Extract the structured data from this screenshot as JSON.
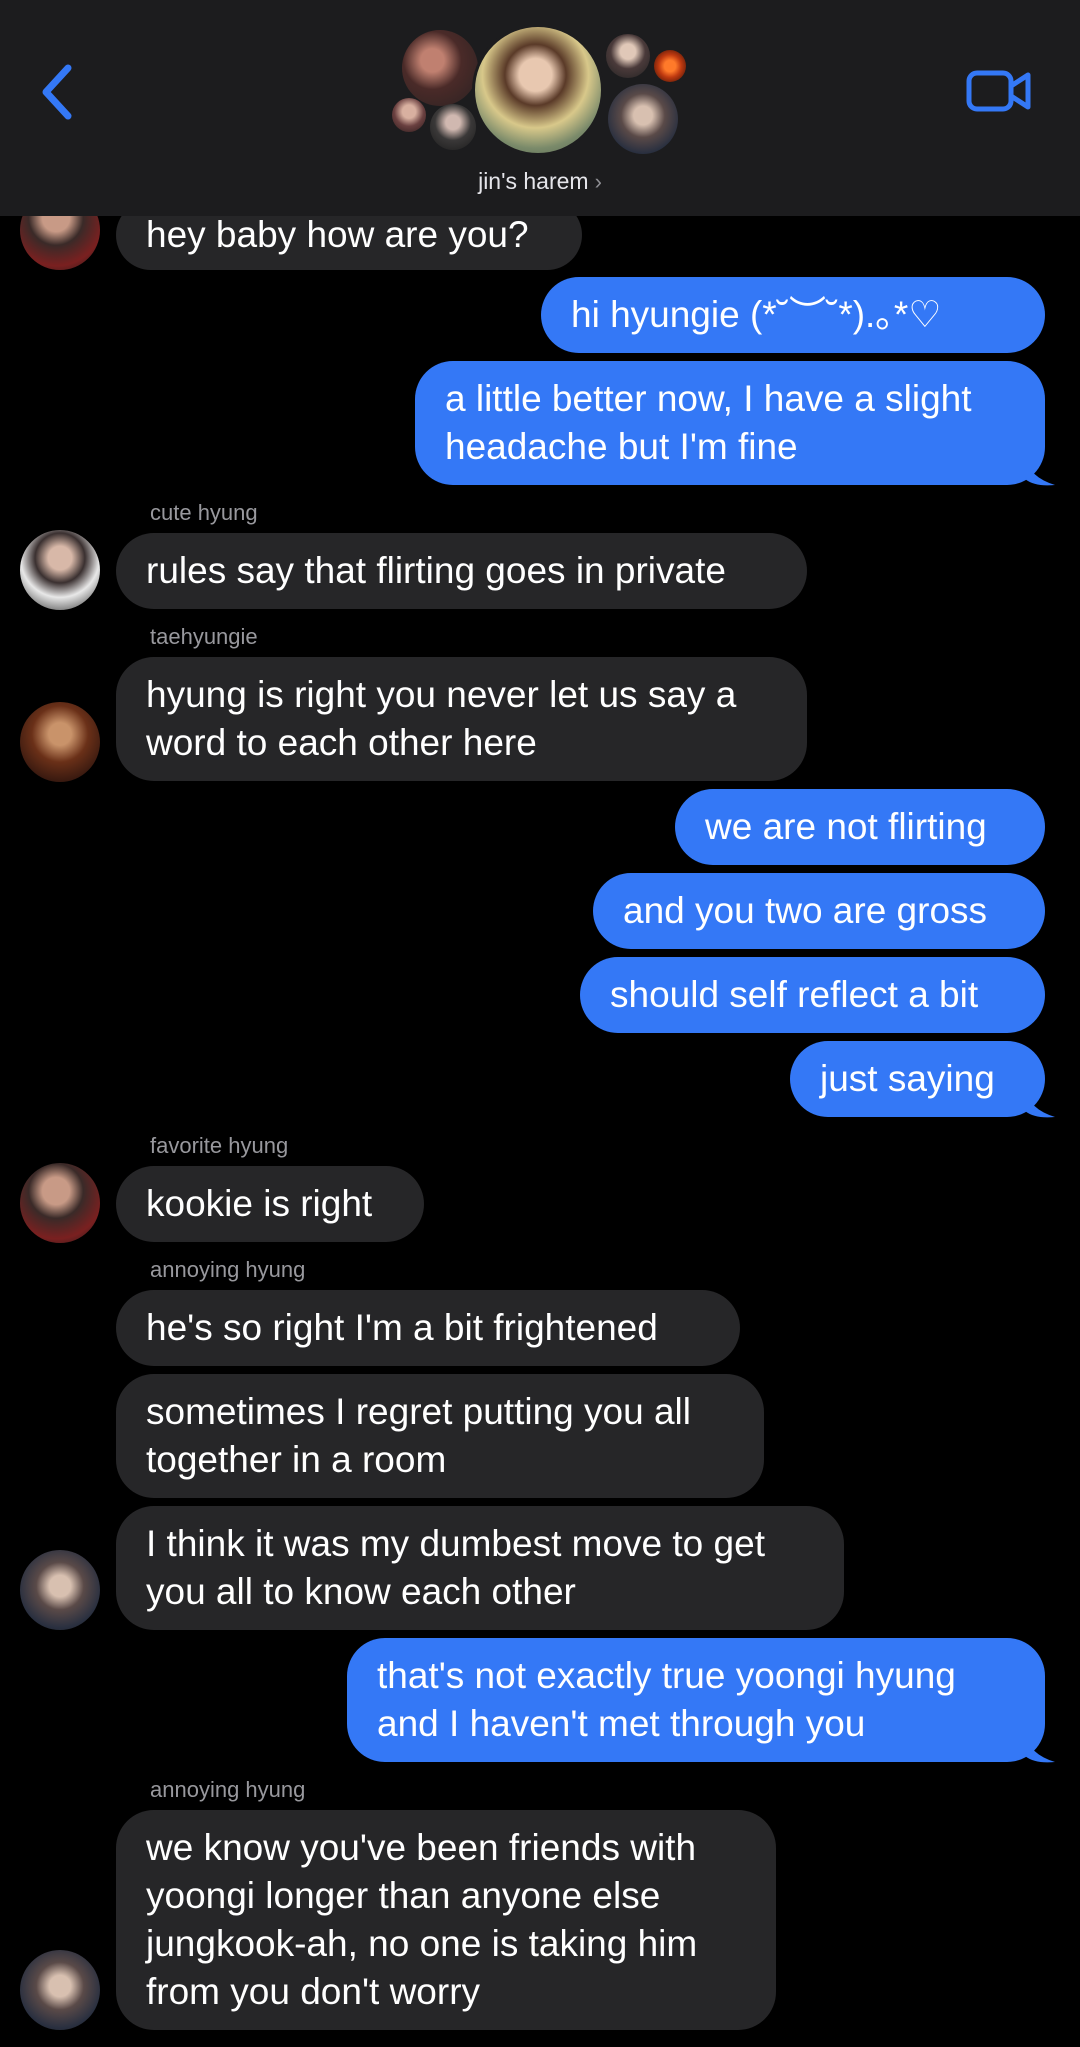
{
  "header": {
    "group_name": "jin's harem",
    "chevron": "›",
    "back_icon": "chevron-left-icon",
    "video_icon": "video-camera-icon"
  },
  "colors": {
    "accent": "#3478f6",
    "incoming_bubble": "#262628",
    "background": "#000000",
    "header": "#1c1c1e"
  },
  "messages": [
    {
      "dir": "in",
      "text": [
        "hey baby how are you?"
      ]
    },
    {
      "dir": "out",
      "text": [
        "hi hyungie (*˘︶˘*).｡*♡"
      ]
    },
    {
      "dir": "out",
      "text": [
        "a little better now, I have a slight",
        "headache but I'm fine"
      ]
    },
    {
      "dir": "in",
      "sender": "cute hyung",
      "text": [
        "rules say that flirting goes in private"
      ]
    },
    {
      "dir": "in",
      "sender": "taehyungie",
      "text": [
        "hyung is right you never let us say a",
        "word to each other here"
      ]
    },
    {
      "dir": "out",
      "text": [
        "we are not flirting"
      ]
    },
    {
      "dir": "out",
      "text": [
        "and you two are gross"
      ]
    },
    {
      "dir": "out",
      "text": [
        "should self reflect a bit"
      ]
    },
    {
      "dir": "out",
      "text": [
        "just saying"
      ]
    },
    {
      "dir": "in",
      "sender": "favorite hyung",
      "text": [
        "kookie is right"
      ]
    },
    {
      "dir": "in",
      "sender": "annoying hyung",
      "text": [
        "he's so right I'm a bit frightened"
      ]
    },
    {
      "dir": "in",
      "text": [
        "sometimes I regret putting you all",
        "together in a room"
      ]
    },
    {
      "dir": "in",
      "text": [
        "I think it was my dumbest move to get",
        "you all to know each other"
      ]
    },
    {
      "dir": "out",
      "text": [
        "that's not exactly true yoongi hyung",
        "and I haven't met through you"
      ]
    },
    {
      "dir": "in",
      "sender": "annoying hyung",
      "text": [
        "we know you've been friends with",
        "yoongi longer than anyone else",
        "jungkook-ah, no one is taking him",
        "from you don't worry"
      ]
    }
  ]
}
